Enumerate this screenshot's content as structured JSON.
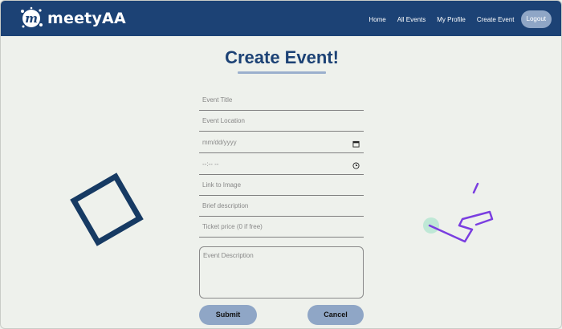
{
  "nav": {
    "logo_text": "meetyAA",
    "links": [
      "Home",
      "All Events",
      "My Profile",
      "Create Event"
    ],
    "logout_label": "Logout"
  },
  "page": {
    "title": "Create Event!"
  },
  "form": {
    "event_title_placeholder": "Event Title",
    "event_location_placeholder": "Event Location",
    "date_placeholder": "mm/dd/yyyy",
    "time_placeholder": "--:-- --",
    "image_link_placeholder": "Link to Image",
    "brief_description_placeholder": "Brief description",
    "ticket_price_placeholder": "Ticket price (0 if free)",
    "event_description_placeholder": "Event Description",
    "submit_label": "Submit",
    "cancel_label": "Cancel"
  },
  "colors": {
    "nav_bg": "#1c4275",
    "page_bg": "#eef1ec",
    "accent": "#8fa6c6",
    "title": "#1c4275",
    "deco_square": "#163a63",
    "deco_purple": "#7a3ee0",
    "deco_mint": "#bfe8d6"
  },
  "icons": {
    "logo": "m-splat-logo",
    "date": "calendar-icon",
    "time": "clock-icon"
  }
}
